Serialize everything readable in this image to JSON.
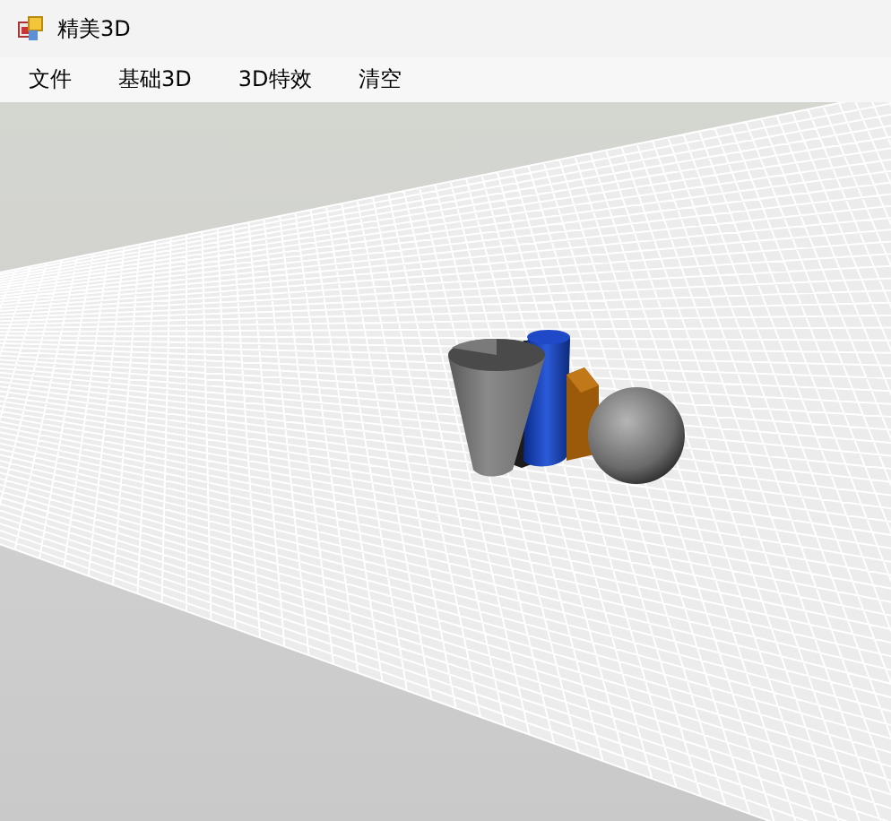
{
  "window": {
    "title": "精美3D"
  },
  "menu": [
    {
      "label": "文件"
    },
    {
      "label": "基础3D"
    },
    {
      "label": "3D特效"
    },
    {
      "label": "清空"
    }
  ]
}
